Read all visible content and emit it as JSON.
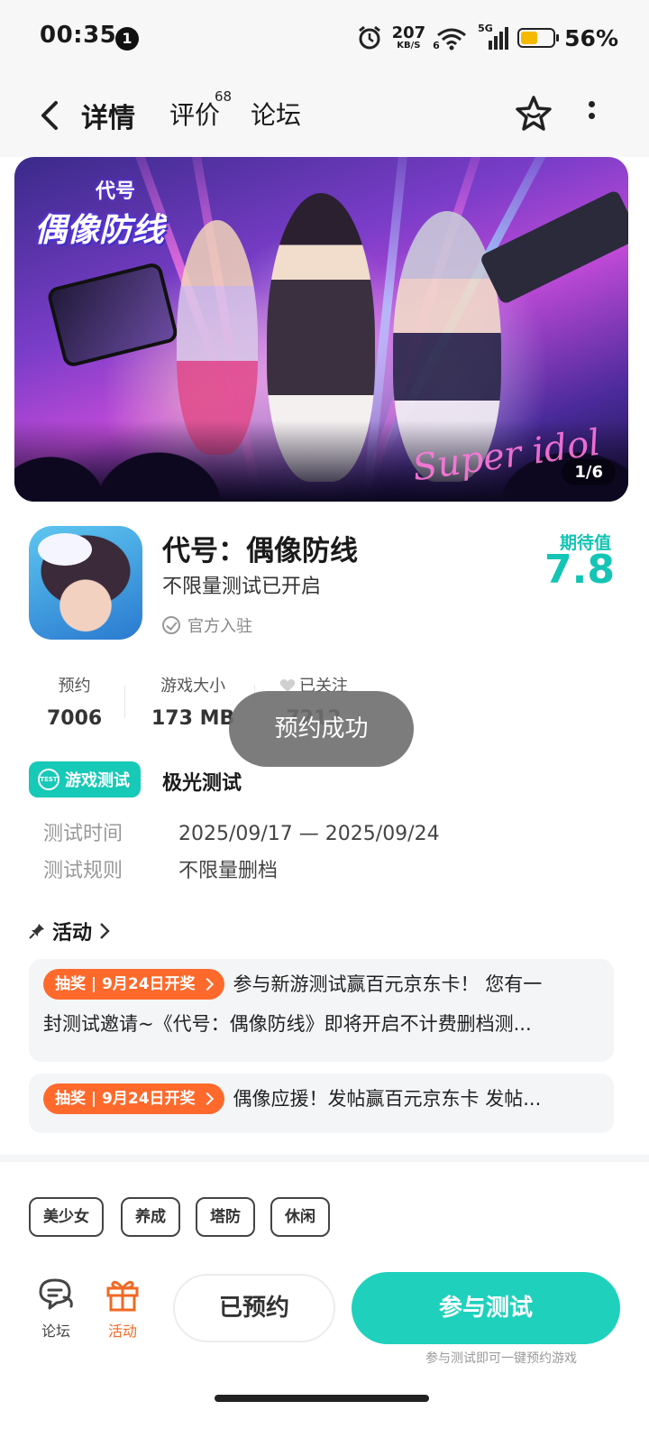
{
  "status_bar": {
    "time": "00:35",
    "notification_count": "1",
    "net_speed": "207",
    "net_unit": "KB/S",
    "wifi_label": "6",
    "signal_label": "5G",
    "battery_percent": "56%",
    "battery_level": 0.56,
    "battery_color": "#f5b900"
  },
  "nav": {
    "tabs": [
      {
        "label": "详情",
        "active": true
      },
      {
        "label": "评价",
        "badge": "68"
      },
      {
        "label": "论坛"
      }
    ],
    "accent": "#2ed3c2"
  },
  "banner": {
    "logo_small": "代号",
    "logo_big": "偶像防线",
    "script_text": "Super idol",
    "page_indicator": "1/6"
  },
  "game": {
    "title": "代号：偶像防线",
    "subtitle": "不限量测试已开启",
    "official": "官方入驻",
    "expect_label": "期待值",
    "expect_value": "7.8"
  },
  "stats": [
    {
      "label": "预约",
      "value": "7006"
    },
    {
      "label": "游戏大小",
      "value": "173 MB"
    },
    {
      "label": "已关注",
      "value": "7212"
    }
  ],
  "toast": "预约成功",
  "test": {
    "badge": "游戏测试",
    "badge_icon_text": "TEST",
    "name": "极光测试",
    "rows": [
      {
        "key": "测试时间",
        "value": "2025/09/17 — 2025/09/24"
      },
      {
        "key": "测试规则",
        "value": "不限量删档"
      }
    ]
  },
  "activity": {
    "title": "活动",
    "items": [
      {
        "tag": "抽奖 | 9月24日开奖",
        "line1": "参与新游测试赢百元京东卡！ 您有一",
        "line2": "封测试邀请~《代号：偶像防线》即将开启不计费删档测..."
      },
      {
        "tag": "抽奖 | 9月24日开奖",
        "line1": "偶像应援！发帖赢百元京东卡 发帖..."
      }
    ]
  },
  "tags": [
    "美少女",
    "养成",
    "塔防",
    "休闲"
  ],
  "bottom_bar": {
    "forum": "论坛",
    "activity": "活动",
    "reserved": "已预约",
    "join": "参与测试",
    "join_note": "参与测试即可一键预约游戏"
  },
  "colors": {
    "teal": "#1fd1bc",
    "orange": "#ff6a2c"
  }
}
